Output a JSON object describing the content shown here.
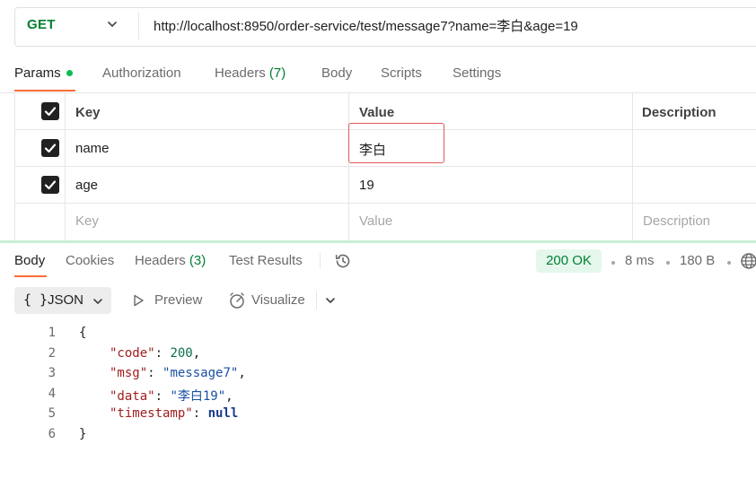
{
  "request": {
    "method": "GET",
    "url": "http://localhost:8950/order-service/test/message7?name=李白&age=19"
  },
  "request_tabs": [
    {
      "label": "Params",
      "active": true
    },
    {
      "label": "Authorization"
    },
    {
      "label": "Headers",
      "count": "(7)"
    },
    {
      "label": "Body"
    },
    {
      "label": "Scripts"
    },
    {
      "label": "Settings"
    }
  ],
  "params": {
    "headers": {
      "key": "Key",
      "value": "Value",
      "description": "Description"
    },
    "rows": [
      {
        "key": "name",
        "value": "李白",
        "checked": true
      },
      {
        "key": "age",
        "value": "19",
        "checked": true
      }
    ],
    "placeholder": {
      "key": "Key",
      "value": "Value",
      "description": "Description"
    }
  },
  "response_tabs": [
    {
      "label": "Body",
      "active": true
    },
    {
      "label": "Cookies"
    },
    {
      "label": "Headers",
      "count": "(3)"
    },
    {
      "label": "Test Results"
    }
  ],
  "response_meta": {
    "status": "200 OK",
    "time": "8 ms",
    "size": "180 B"
  },
  "response_toolbar": {
    "format_glyph": "{ }",
    "format": "JSON",
    "preview": "Preview",
    "visualize": "Visualize"
  },
  "response_body": {
    "line_numbers": [
      "1",
      "2",
      "3",
      "4",
      "5",
      "6"
    ],
    "open_brace": "{",
    "close_brace": "}",
    "fields": [
      {
        "key": "\"code\"",
        "value": "200",
        "type": "number",
        "comma": ","
      },
      {
        "key": "\"msg\"",
        "value": "\"message7\"",
        "type": "string",
        "comma": ","
      },
      {
        "key": "\"data\"",
        "value": "\"李白19\"",
        "type": "string",
        "comma": ","
      },
      {
        "key": "\"timestamp\"",
        "value": "null",
        "type": "keyword",
        "comma": ""
      }
    ]
  },
  "colors": {
    "accent": "#ff6c37",
    "method_green": "#007f31",
    "status_bg": "#e5f7ec",
    "highlight_red": "#e05757"
  }
}
